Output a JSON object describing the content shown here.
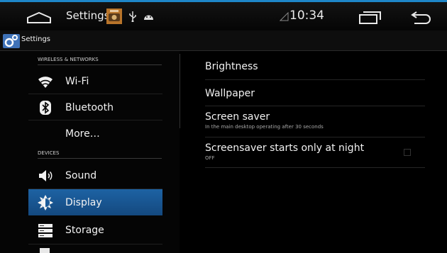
{
  "statusbar": {
    "title": "Settings",
    "clock": "10:34",
    "icons": [
      "home-icon",
      "photo-notification-icon",
      "usb-icon",
      "android-icon",
      "signal-icon",
      "recent-apps-icon",
      "back-icon"
    ]
  },
  "actionbar": {
    "title": "Settings",
    "icon": "settings-app-icon"
  },
  "sidebar": {
    "sections": [
      {
        "header": "WIRELESS & NETWORKS"
      },
      {
        "header": "DEVICES"
      }
    ],
    "items": [
      {
        "label": "Wi-Fi",
        "icon": "wifi-icon"
      },
      {
        "label": "Bluetooth",
        "icon": "bluetooth-icon"
      },
      {
        "label": "More…",
        "icon": ""
      },
      {
        "label": "Sound",
        "icon": "speaker-icon"
      },
      {
        "label": "Display",
        "icon": "display-icon",
        "selected": true
      },
      {
        "label": "Storage",
        "icon": "storage-icon"
      }
    ]
  },
  "display_settings": {
    "items": [
      {
        "title": "Brightness"
      },
      {
        "title": "Wallpaper"
      },
      {
        "title": "Screen saver",
        "summary": "In the main desktop operating after 30 seconds"
      },
      {
        "title": "Screensaver starts only at night",
        "summary": "OFF",
        "checked": false
      }
    ]
  },
  "colors": {
    "accent": "#1e86c8",
    "selected_bg": "#1a5a99",
    "background": "#000000"
  }
}
